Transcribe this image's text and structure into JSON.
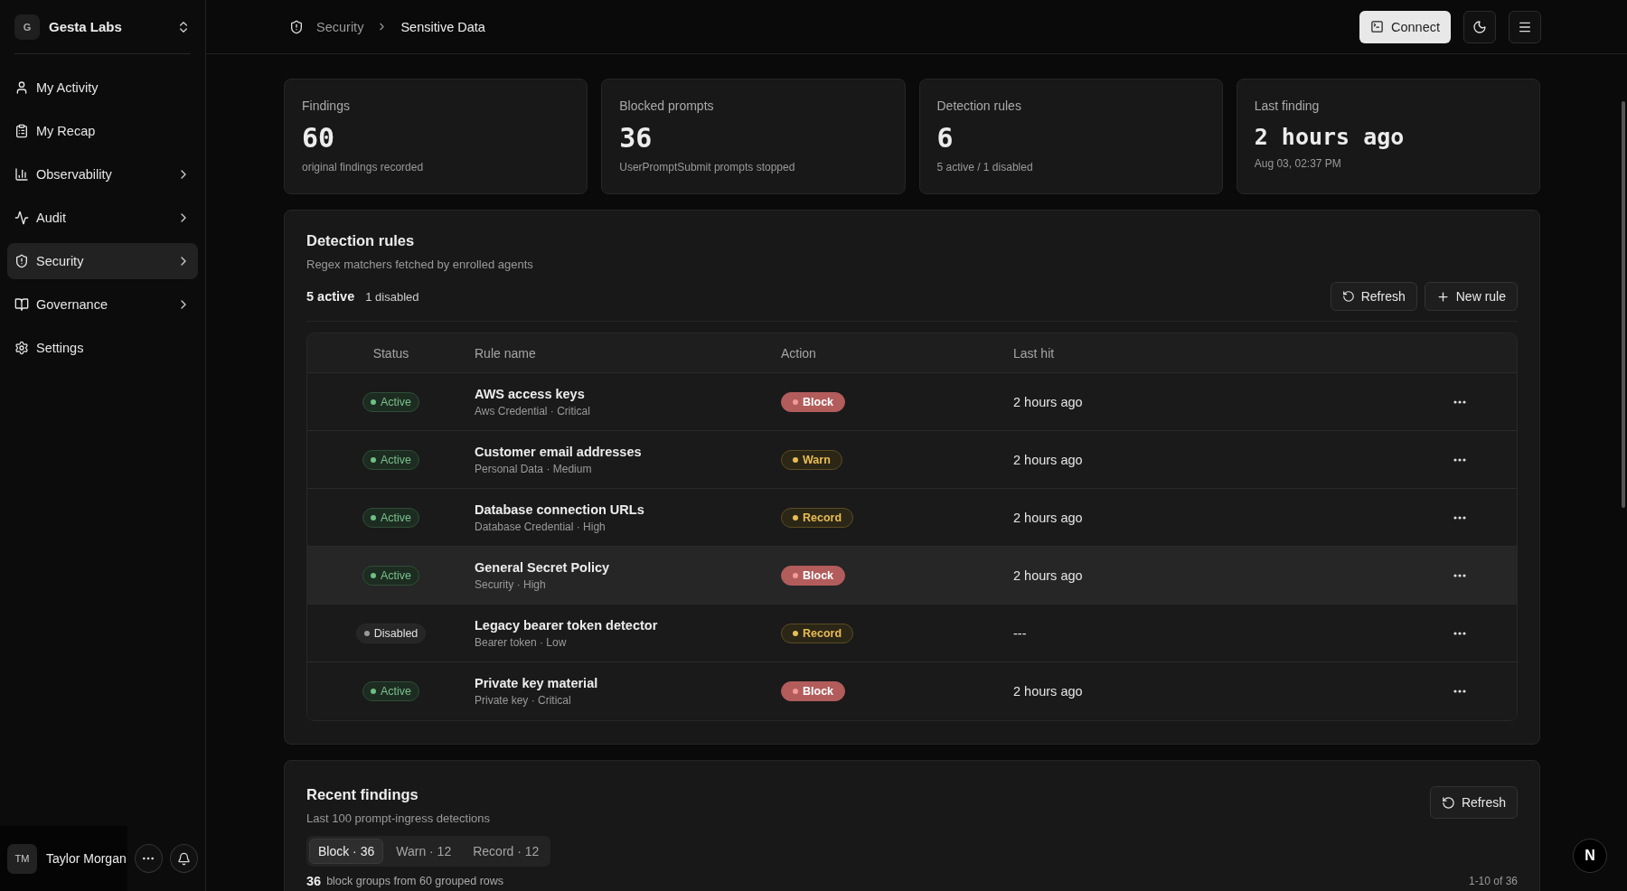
{
  "sidebar": {
    "workspace": {
      "initial": "G",
      "name": "Gesta Labs"
    },
    "items": [
      {
        "label": "My Activity",
        "expandable": false,
        "selected": false
      },
      {
        "label": "My Recap",
        "expandable": false,
        "selected": false
      },
      {
        "label": "Observability",
        "expandable": true,
        "selected": false
      },
      {
        "label": "Audit",
        "expandable": true,
        "selected": false
      },
      {
        "label": "Security",
        "expandable": true,
        "selected": true
      },
      {
        "label": "Governance",
        "expandable": true,
        "selected": false
      },
      {
        "label": "Settings",
        "expandable": false,
        "selected": false
      }
    ],
    "user": {
      "initials": "TM",
      "name": "Taylor Morgan"
    }
  },
  "header": {
    "breadcrumb": [
      "Security",
      "Sensitive Data"
    ],
    "connect": "Connect"
  },
  "stats": [
    {
      "label": "Findings",
      "value": "60",
      "note": "original findings recorded",
      "kind": "count"
    },
    {
      "label": "Blocked prompts",
      "value": "36",
      "note": "UserPromptSubmit prompts stopped",
      "kind": "count"
    },
    {
      "label": "Detection rules",
      "value": "6",
      "note": "5 active / 1 disabled",
      "kind": "count"
    },
    {
      "label": "Last finding",
      "value": "2 hours ago",
      "note": "Aug 03, 02:37 PM",
      "kind": "time"
    }
  ],
  "rules_panel": {
    "title": "Detection rules",
    "subtitle": "Regex matchers fetched by enrolled agents",
    "active_count": "5 active",
    "disabled_count": "1 disabled",
    "refresh": "Refresh",
    "new_rule": "New rule",
    "columns": [
      "Status",
      "Rule name",
      "Action",
      "Last hit"
    ],
    "rows": [
      {
        "status": "Active",
        "active": true,
        "name": "AWS access keys",
        "meta": "Aws Credential · Critical",
        "action": {
          "label": "Block",
          "kind": "block"
        },
        "last_hit": "2 hours ago",
        "highlighted": false
      },
      {
        "status": "Active",
        "active": true,
        "name": "Customer email addresses",
        "meta": "Personal Data · Medium",
        "action": {
          "label": "Warn",
          "kind": "warn"
        },
        "last_hit": "2 hours ago",
        "highlighted": false
      },
      {
        "status": "Active",
        "active": true,
        "name": "Database connection URLs",
        "meta": "Database Credential · High",
        "action": {
          "label": "Record",
          "kind": "record"
        },
        "last_hit": "2 hours ago",
        "highlighted": false
      },
      {
        "status": "Active",
        "active": true,
        "name": "General Secret Policy",
        "meta": "Security · High",
        "action": {
          "label": "Block",
          "kind": "block"
        },
        "last_hit": "2 hours ago",
        "highlighted": true
      },
      {
        "status": "Disabled",
        "active": false,
        "name": "Legacy bearer token detector",
        "meta": "Bearer token · Low",
        "action": {
          "label": "Record",
          "kind": "record"
        },
        "last_hit": "---",
        "highlighted": false
      },
      {
        "status": "Active",
        "active": true,
        "name": "Private key material",
        "meta": "Private key · Critical",
        "action": {
          "label": "Block",
          "kind": "block"
        },
        "last_hit": "2 hours ago",
        "highlighted": false
      }
    ]
  },
  "findings_panel": {
    "title": "Recent findings",
    "subtitle": "Last 100 prompt-ingress detections",
    "refresh": "Refresh",
    "tabs": [
      {
        "label": "Block · 36",
        "selected": true
      },
      {
        "label": "Warn · 12",
        "selected": false
      },
      {
        "label": "Record · 12",
        "selected": false
      }
    ],
    "summary_count": "36",
    "summary_text": "block groups from 60 grouped rows",
    "pagination": "1-10 of 36"
  },
  "dev_badge": "N"
}
